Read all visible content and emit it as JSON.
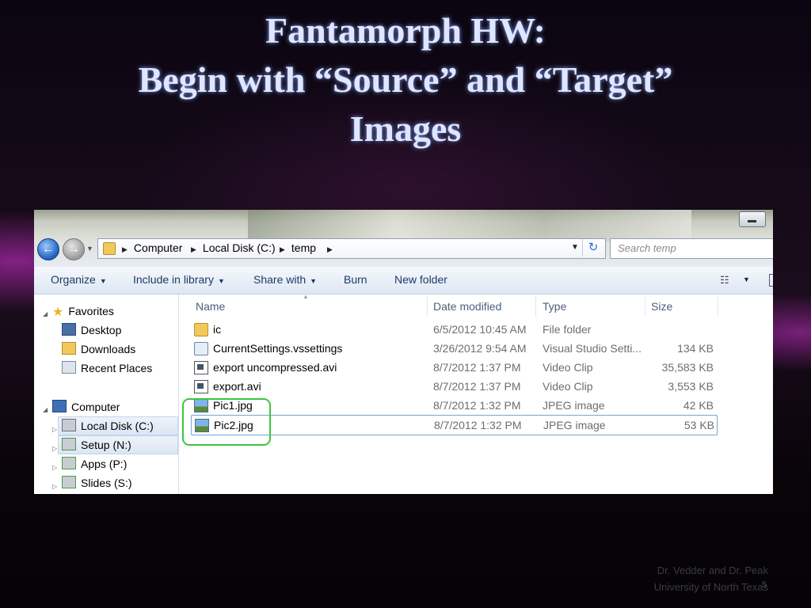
{
  "slide": {
    "title_lines": [
      "Fantamorph HW:",
      "Begin with “Source” and “Target”",
      "Images"
    ],
    "footer_lines": [
      "Dr. Vedder and Dr. Peak",
      "University of North Texas"
    ],
    "page_number": "5"
  },
  "window": {
    "nav": {
      "back_glyph": "←",
      "forward_glyph": "→"
    },
    "breadcrumb": [
      "Computer",
      "Local Disk (C:)",
      "temp"
    ],
    "refresh_glyph": "↻",
    "search_placeholder": "Search temp"
  },
  "toolbar": {
    "organize": "Organize",
    "include_in_library": "Include in library",
    "share_with": "Share with",
    "burn": "Burn",
    "new_folder": "New folder",
    "view_glyph": "☷"
  },
  "nav_pane": {
    "favorites": {
      "label": "Favorites",
      "items": [
        "Desktop",
        "Downloads",
        "Recent Places"
      ]
    },
    "computer": {
      "label": "Computer",
      "items": [
        "Local Disk (C:)",
        "Setup (N:)",
        "Apps (P:)",
        "Slides (S:)"
      ]
    }
  },
  "columns": {
    "name": "Name",
    "date_modified": "Date modified",
    "type": "Type",
    "size": "Size"
  },
  "files": [
    {
      "name": "ic",
      "date": "6/5/2012 10:45 AM",
      "type": "File folder",
      "size": "",
      "icon": "folder-icon"
    },
    {
      "name": "CurrentSettings.vssettings",
      "date": "3/26/2012 9:54 AM",
      "type": "Visual Studio Setti...",
      "size": "134 KB",
      "icon": "settings-file-icon"
    },
    {
      "name": "export uncompressed.avi",
      "date": "8/7/2012 1:37 PM",
      "type": "Video Clip",
      "size": "35,583 KB",
      "icon": "video-file-icon"
    },
    {
      "name": "export.avi",
      "date": "8/7/2012 1:37 PM",
      "type": "Video Clip",
      "size": "3,553 KB",
      "icon": "video-file-icon"
    },
    {
      "name": "Pic1.jpg",
      "date": "8/7/2012 1:32 PM",
      "type": "JPEG image",
      "size": "42 KB",
      "icon": "image-file-icon"
    },
    {
      "name": "Pic2.jpg",
      "date": "8/7/2012 1:32 PM",
      "type": "JPEG image",
      "size": "53 KB",
      "icon": "image-file-icon"
    }
  ],
  "colors": {
    "title_text": "#dfe6ff",
    "highlight_ring": "#3ec43e",
    "toolbar_text": "#1e3a66"
  }
}
